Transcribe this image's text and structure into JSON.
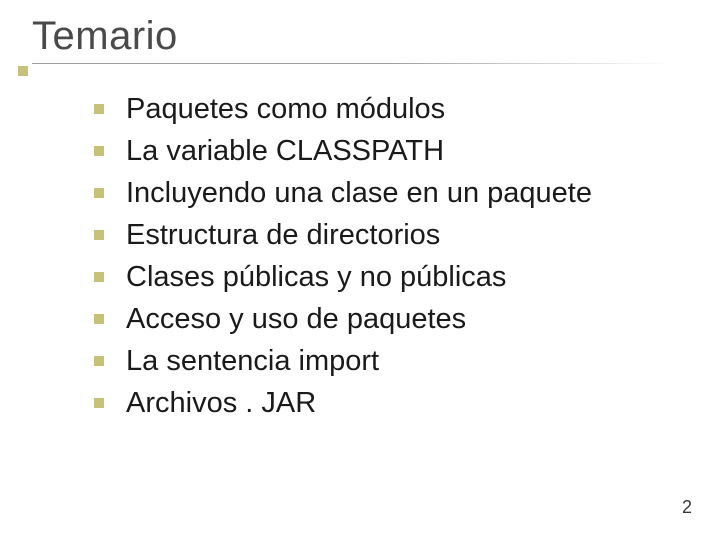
{
  "title": "Temario",
  "bullets": [
    "Paquetes como módulos",
    "La variable CLASSPATH",
    "Incluyendo una clase en un paquete",
    "Estructura de directorios",
    "Clases públicas y no públicas",
    "Acceso y uso de paquetes",
    "La sentencia import",
    "Archivos . JAR"
  ],
  "page_number": "2"
}
